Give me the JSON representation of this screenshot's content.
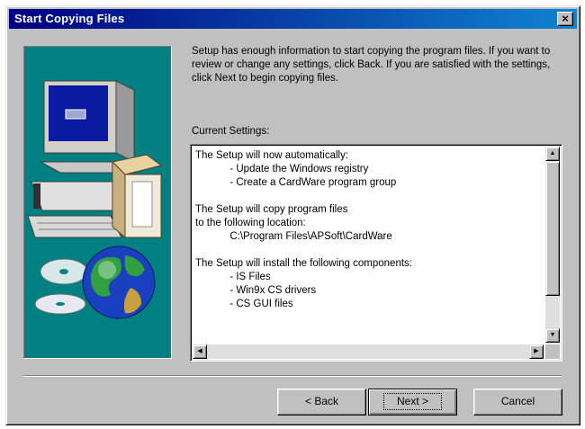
{
  "window": {
    "title": "Start Copying Files",
    "close_glyph": "×"
  },
  "intro_text": "Setup has enough information to start copying the program files. If you want to review or change any settings, click Back.  If you are satisfied with the settings, click Next to begin copying files.",
  "settings_label": "Current Settings:",
  "settings_lines": [
    "The Setup will now automatically:",
    "            - Update the Windows registry",
    "            - Create a CardWare program group",
    "",
    "The Setup will copy program files",
    "to the following location:",
    "            C:\\Program Files\\APSoft\\CardWare",
    "",
    "The Setup will install the following components:",
    "            - IS Files",
    "            - Win9x CS drivers",
    "            - CS GUI files"
  ],
  "scrollbar_glyphs": {
    "up": "▲",
    "down": "▼",
    "left": "◀",
    "right": "▶"
  },
  "buttons": {
    "back": "< Back",
    "next": "Next >",
    "cancel": "Cancel"
  },
  "icons": [
    "computer-icon",
    "cd-disc-icon",
    "globe-icon",
    "close-icon"
  ]
}
